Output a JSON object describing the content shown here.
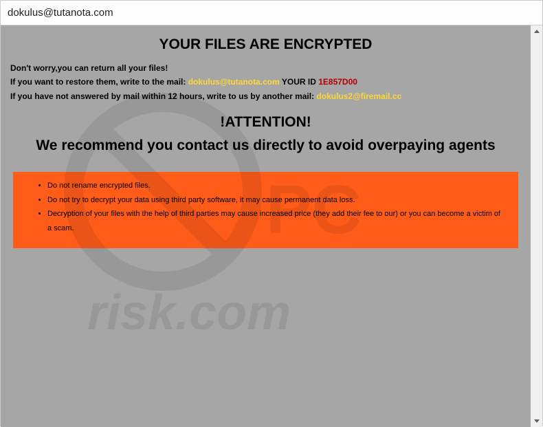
{
  "window": {
    "title": "dokulus@tutanota.com"
  },
  "content": {
    "main_heading": "YOUR FILES ARE ENCRYPTED",
    "line1": "Don't worry,you can return all your files!",
    "line2_prefix": "If you want to restore them, write to the mail:  ",
    "email1": "dokulus@tutanota.com",
    "id_label": "  YOUR ID ",
    "id_value": "1E857D00",
    "line3_prefix": "If you have not answered by mail within 12 hours, write to us by another mail: ",
    "email2": "dokulus2@firemail.cc",
    "attention_heading": "!ATTENTION!",
    "recommend_text": "We recommend you contact us directly to avoid overpaying agents",
    "warnings": [
      "Do not rename encrypted files.",
      "Do not try to decrypt your data using third party software, it may cause permanent data loss.",
      "Decryption of your files with the help of third parties may cause increased price (they add their fee to our) or you can become a victim of a scam."
    ]
  }
}
